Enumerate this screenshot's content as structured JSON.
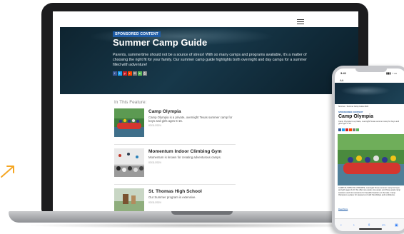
{
  "laptop_page": {
    "badge": "SPONSORED CONTENT",
    "title": "Summer Camp Guide",
    "description": "Parents, summertime should not be a source of stress! With so many camps and programs available, it's a matter of choosing the right fit for your family. Our summer camp guide highlights both overnight and day camps for a summer filled with adventure!",
    "share_buttons": [
      {
        "icon": "facebook-icon",
        "color": "#3b5998",
        "glyph": "f"
      },
      {
        "icon": "twitter-icon",
        "color": "#1da1f2",
        "glyph": "t"
      },
      {
        "icon": "pinterest-icon",
        "color": "#cb2027",
        "glyph": "p"
      },
      {
        "icon": "reddit-icon",
        "color": "#ff4500",
        "glyph": "r"
      },
      {
        "icon": "email-icon",
        "color": "#7a7a7a",
        "glyph": "✉"
      },
      {
        "icon": "sms-icon",
        "color": "#5cb85c",
        "glyph": "s"
      },
      {
        "icon": "print-icon",
        "color": "#888888",
        "glyph": "⎙"
      }
    ],
    "in_this_feature": "In This Feature:",
    "articles": [
      {
        "title": "Camp Olympia",
        "description": "Camp Olympia is a private, overnight Texas summer camp for boys and girls ages 6-16.",
        "date": "03/11/2024"
      },
      {
        "title": "Momentum Indoor Climbing Gym",
        "description": "Momentum is known for creating adventurous camps.",
        "date": "03/11/2024"
      },
      {
        "title": "St. Thomas High School",
        "description": "Our Summer program is extensive.",
        "date": "03/11/2024"
      }
    ]
  },
  "phone_page": {
    "time": "3:41",
    "status_icons": "▮▮▮ ◔ ▭",
    "aa": "AA",
    "breadcrumb": "Summer › Summer Camp Guide 2024",
    "badge": "SPONSORED CONTENT",
    "title": "Camp Olympia",
    "description": "Camp Olympia is a private, overnight Texas summer camp for boys and girls ages 6-16.",
    "body": "CAMP OLYMPIA IS A PRIVATE, overnight Texas summer camp for boys and girls ages 6-16. We offer one-week, two-week, and three-week camp sessions and mini-sessions for beautiful location on the lake. Camp Olympia is a place for campers to build friendships and confidence.",
    "more": "Read More",
    "toolbar": [
      "‹",
      "›",
      "⇧",
      "▭",
      "▣"
    ]
  },
  "colors": {
    "accent": "#1f5da8",
    "hero_dark": "#0e2430",
    "arrow": "#f5a623"
  }
}
